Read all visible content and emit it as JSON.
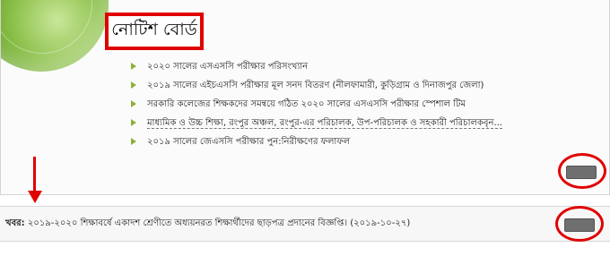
{
  "board": {
    "title": "নোটিশ বোর্ড",
    "notices": [
      {
        "text": "২০২০ সালের এসএসসি পরীক্ষার পরিসংখ্যান"
      },
      {
        "text": "২০১৯ সালের এইচএসসি পরীক্ষার মূল সনদ বিতরণ (নীলফামারী, কুড়িগ্রাম ও দিনাজপুর জেলা)"
      },
      {
        "text": "সরকারি কলেজের শিক্ষকদের সমন্বয়ে গঠিত ২০২০ সালের এসএসসি পরীক্ষার স্পেশাল টিম"
      },
      {
        "text": "মাধ্যমিক ও উচ্চ শিক্ষা, রংপুর অঞ্চল, রংপুর-এর পরিচালক, উপ-পরিচালক ও সহকারী পরিচালকবৃন..."
      },
      {
        "text": "২০১৯ সালের জেএসসি পরীক্ষার পুন:নিরীক্ষণের ফলাফল"
      }
    ]
  },
  "ticker": {
    "label": "খবর:",
    "text": " ২০১৯-২০২০ শিক্ষাবর্ষে একাদশ শ্রেণীতে অধ্যয়নরত শিক্ষার্থীদের ছাড়পত্র প্রদানের বিজ্ঞপ্তি। (২০১৯-১০-২৭)"
  },
  "colors": {
    "annotation_red": "#e00000",
    "bullet_green": "#8db03a",
    "globe_green": "#6aa52c"
  }
}
